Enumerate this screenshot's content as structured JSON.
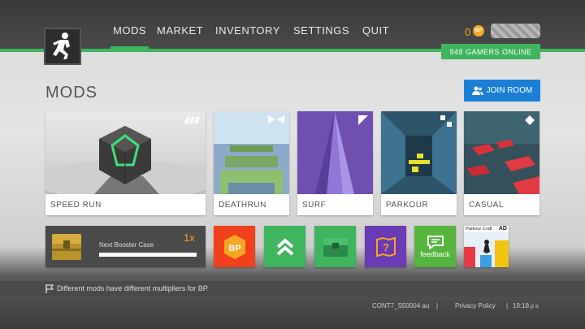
{
  "nav": {
    "items": [
      {
        "label": "MODS",
        "active": true
      },
      {
        "label": "MARKET",
        "active": false
      },
      {
        "label": "INVENTORY",
        "active": false
      },
      {
        "label": "SETTINGS",
        "active": false
      },
      {
        "label": "QUIT",
        "active": false
      }
    ]
  },
  "header": {
    "coins": "0",
    "coin_icon_text": "BP",
    "online": "948 GAMERS ONLINE",
    "accent_color": "#3fb55f"
  },
  "page": {
    "title": "MODS",
    "join_room_label": "JOIN ROOM"
  },
  "modes": [
    {
      "label": "SPEED RUN",
      "icon": "signal-bars-icon"
    },
    {
      "label": "DEATHRUN",
      "icon": "bowtie-icon"
    },
    {
      "label": "SURF",
      "icon": "triangle-icon"
    },
    {
      "label": "PARKOUR",
      "icon": "squares-icon"
    },
    {
      "label": "CASUAL",
      "icon": "diamond-icon"
    }
  ],
  "booster": {
    "label": "Next Booster Case",
    "multiplier": "1x",
    "progress": 1.0
  },
  "tiles": [
    {
      "name": "bp-tile",
      "color": "#f0401e",
      "icon": "bp-badge-icon"
    },
    {
      "name": "rank-up-tile",
      "color": "#3fb55f",
      "icon": "double-chevron-up-icon"
    },
    {
      "name": "case-tile",
      "color": "#3fb55f",
      "icon": "case-icon"
    },
    {
      "name": "mystery-tile",
      "color": "#6b3ab5",
      "icon": "question-map-icon"
    },
    {
      "name": "feedback-tile",
      "color": "#56b53f",
      "icon": "speech-bubble-icon",
      "label": "feedback"
    }
  ],
  "ad": {
    "title": "Parkour Craft",
    "badge": "AD"
  },
  "tip": {
    "text": "Different mods have different multipliers for BP."
  },
  "footer": {
    "server": "CONT7_S50004 au",
    "privacy": "Privacy Policy",
    "time": "19:18",
    "suffix": "p a"
  }
}
